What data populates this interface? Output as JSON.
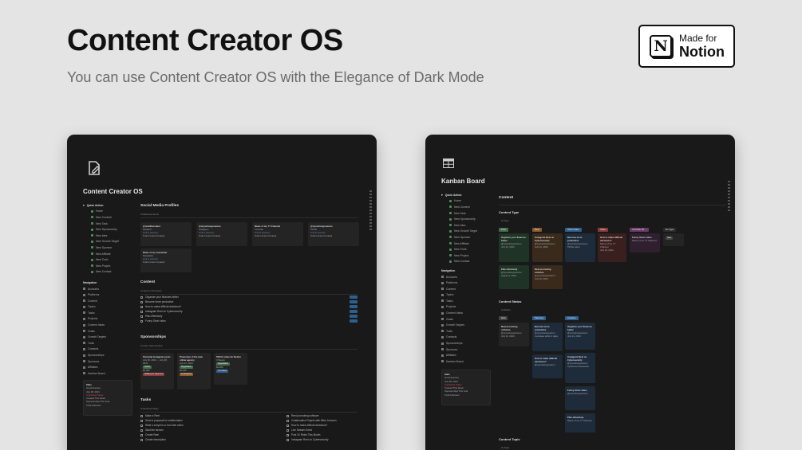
{
  "hero": {
    "title": "Content Creator OS",
    "subtitle": "You can use Content Creator OS with the Elegance of Dark Mode"
  },
  "badge": {
    "logo": "N",
    "line1": "Made for",
    "line2": "Notion"
  },
  "left_window": {
    "page_title": "Content Creator OS",
    "icon": "edit-document-icon",
    "sidebar": {
      "quick_action": "Quick Action",
      "items": [
        "Home",
        "New Content",
        "New Task",
        "New Sponsorship",
        "New Idea",
        "New Growth Target",
        "New Sponsor",
        "New Affiliate",
        "New Tools",
        "New Project",
        "New Contact"
      ],
      "nav_title": "Navigation",
      "nav": [
        "Accounts",
        "Platforms",
        "Content",
        "Topics",
        "Tasks",
        "Projects",
        "Content Ideas",
        "Goals",
        "Growth Targets",
        "Tools",
        "Contacts",
        "Sponsorships",
        "Sponsors",
        "Affiliates",
        "Kanban Board"
      ],
      "board": "Board"
    },
    "sections": {
      "social": "Social Media Profiles",
      "social_sub": "Profiles/Accounts",
      "content": "Content",
      "content_sub": "Content in Progress",
      "sponsorships": "Sponsorships",
      "sponsorships_sub": "Current Sponsorship",
      "tasks": "Tasks",
      "tasks_sub": "Unfinished Tasks"
    },
    "profiles": [
      {
        "name": "@notelifecreator",
        "platform": "Twitter/X"
      },
      {
        "name": "@mynotiongrowsmo",
        "platform": "Instagram"
      },
      {
        "name": "Name of my YT Channel",
        "platform": "YouTube"
      },
      {
        "name": "@mynotiongrowsmo",
        "platform": "TikTok"
      },
      {
        "name": "Name of my newsletter",
        "platform": "Newsletter"
      }
    ],
    "content_rows": [
      "Organize your finances better",
      "Become more productive",
      "How to make difficult decisions?",
      "Instagram Reel on Cybersecurity",
      "Plan effectively",
      "Funny Short video"
    ],
    "sponsor_cards": [
      {
        "title": "Financial Instagram posts",
        "date": "July 26, 2024 → July 28, 2024"
      },
      {
        "title": "Promotion of the task online agency",
        "date": "July 21, 2024"
      },
      {
        "title": "TikTok video for Notion",
        "date": "3 Weeks"
      }
    ],
    "tasks_left": [
      "Make a Reel",
      "Send a proposal for collaboration",
      "Write a script for a YouTube video",
      "Start the stream",
      "Create Reel",
      "Create description"
    ],
    "tasks_right": [
      "Reel promoting software",
      "Collaborative Project with Mike Johnson",
      "How to make difficult decisions?",
      "Live Stream Event",
      "Post 10 Reels This Month",
      "Instagram Reel on Cybersecurity"
    ]
  },
  "right_window": {
    "page_title": "Kanban Board",
    "icon": "table-icon",
    "sections": {
      "content": "Content",
      "type": "Content Type",
      "status": "Content Status",
      "topic": "Content Topic"
    },
    "type_columns": [
      "Post",
      "Reel",
      "Short Video",
      "Video",
      "YouTube Sh...",
      "No Type"
    ],
    "status_columns": [
      "Idea",
      "Planning",
      "Creation"
    ],
    "cards": [
      "Organize your finances better",
      "Instagram Reel on Cybersecurity",
      "Become more productive",
      "How to make difficult decisions?",
      "Funny Short video",
      "Plan effectively",
      "Reel promoting software",
      "TikTok video for Notion"
    ]
  },
  "colors": {
    "background": "#e4e4e4",
    "window": "#191919",
    "card": "#242424",
    "green_tag": "#3f6f4a",
    "blue_tag": "#2f5f8f",
    "orange_tag": "#8a5a2c",
    "red_tag": "#8a3a3a"
  }
}
